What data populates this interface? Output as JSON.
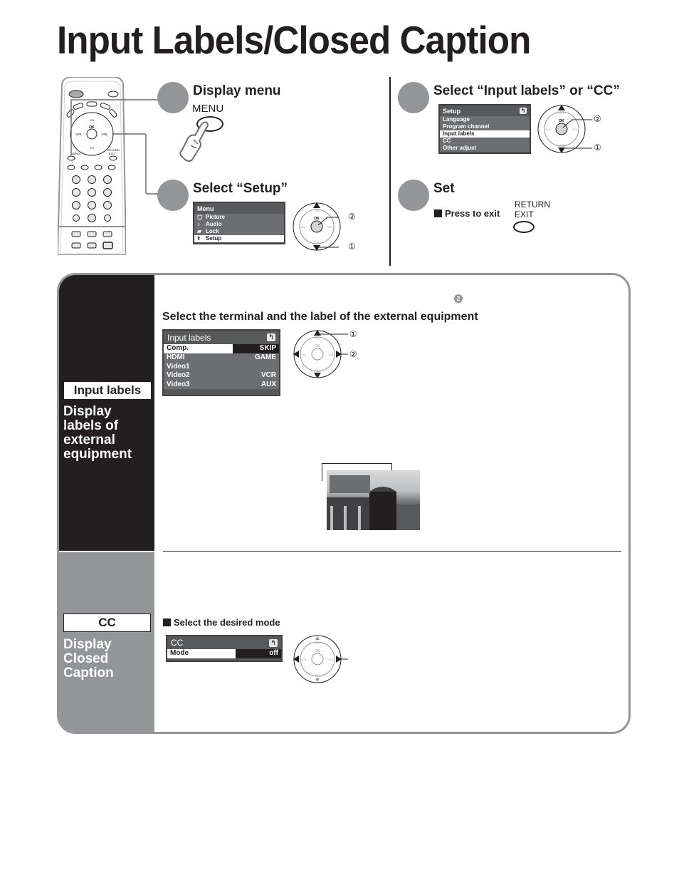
{
  "page": {
    "title": "Input Labels/Closed Caption"
  },
  "remote": {
    "labels": {
      "ok": "OK",
      "ch": "CH",
      "vol": "VOL",
      "menu": "MENU",
      "return_exit": "RETURN EXIT"
    }
  },
  "steps": [
    {
      "title": "Display menu",
      "button_label": "MENU"
    },
    {
      "title": "Select “Setup”",
      "menu": {
        "header": "Menu",
        "items": [
          {
            "icon": "picture-icon",
            "glyph": "▢",
            "label": "Picture",
            "selected": false
          },
          {
            "icon": "audio-icon",
            "glyph": "♪",
            "label": "Audio",
            "selected": false
          },
          {
            "icon": "lock-icon",
            "glyph": "▰",
            "label": "Lock",
            "selected": false
          },
          {
            "icon": "setup-icon",
            "glyph": "⚕",
            "label": "Setup",
            "selected": true
          }
        ]
      },
      "callouts": [
        "②",
        "①"
      ]
    },
    {
      "title": "Select “Input labels” or “CC”",
      "menu": {
        "header": "Setup",
        "back_glyph": "↰",
        "items": [
          {
            "label": "Language",
            "selected": false
          },
          {
            "label": "Program channel",
            "selected": false
          },
          {
            "label": "Input labels",
            "selected": true
          },
          {
            "label": "CC",
            "selected": false
          },
          {
            "label": "Other adjust",
            "selected": false
          }
        ]
      },
      "callouts": [
        "②",
        "①"
      ]
    },
    {
      "title": "Set",
      "exit_note": "Press to exit",
      "button_label_line1": "RETURN",
      "button_label_line2": "EXIT"
    }
  ],
  "dpad": {
    "ok": "OK",
    "ch": "CH",
    "vol": "VOL"
  },
  "input_labels_section": {
    "tag": "Input labels",
    "description_lines": [
      "Display",
      "labels of",
      "external",
      "equipment"
    ],
    "step_marker": "❷",
    "subheading": "Select the terminal and the label of the external equipment",
    "menu": {
      "header": "Input labels",
      "back_glyph": "↰",
      "rows": [
        {
          "terminal": "Comp.",
          "label": "SKIP",
          "selected": true
        },
        {
          "terminal": "HDMI",
          "label": "GAME",
          "selected": false
        },
        {
          "terminal": "Video1",
          "label": "",
          "selected": false
        },
        {
          "terminal": "Video2",
          "label": "VCR",
          "selected": false
        },
        {
          "terminal": "Video3",
          "label": "AUX",
          "selected": false
        }
      ]
    },
    "callouts": [
      "①",
      "②"
    ]
  },
  "cc_section": {
    "tag": "CC",
    "description_lines": [
      "Display",
      "Closed",
      "Caption"
    ],
    "subheading": "Select the desired mode",
    "menu": {
      "header": "CC",
      "back_glyph": "↰",
      "rows": [
        {
          "label": "Mode",
          "value": "off",
          "selected": true
        }
      ]
    }
  },
  "colors": {
    "text": "#231f20",
    "accent_gray": "#939598",
    "osd_bg": "#58595b",
    "dark_panel": "#231f20"
  }
}
